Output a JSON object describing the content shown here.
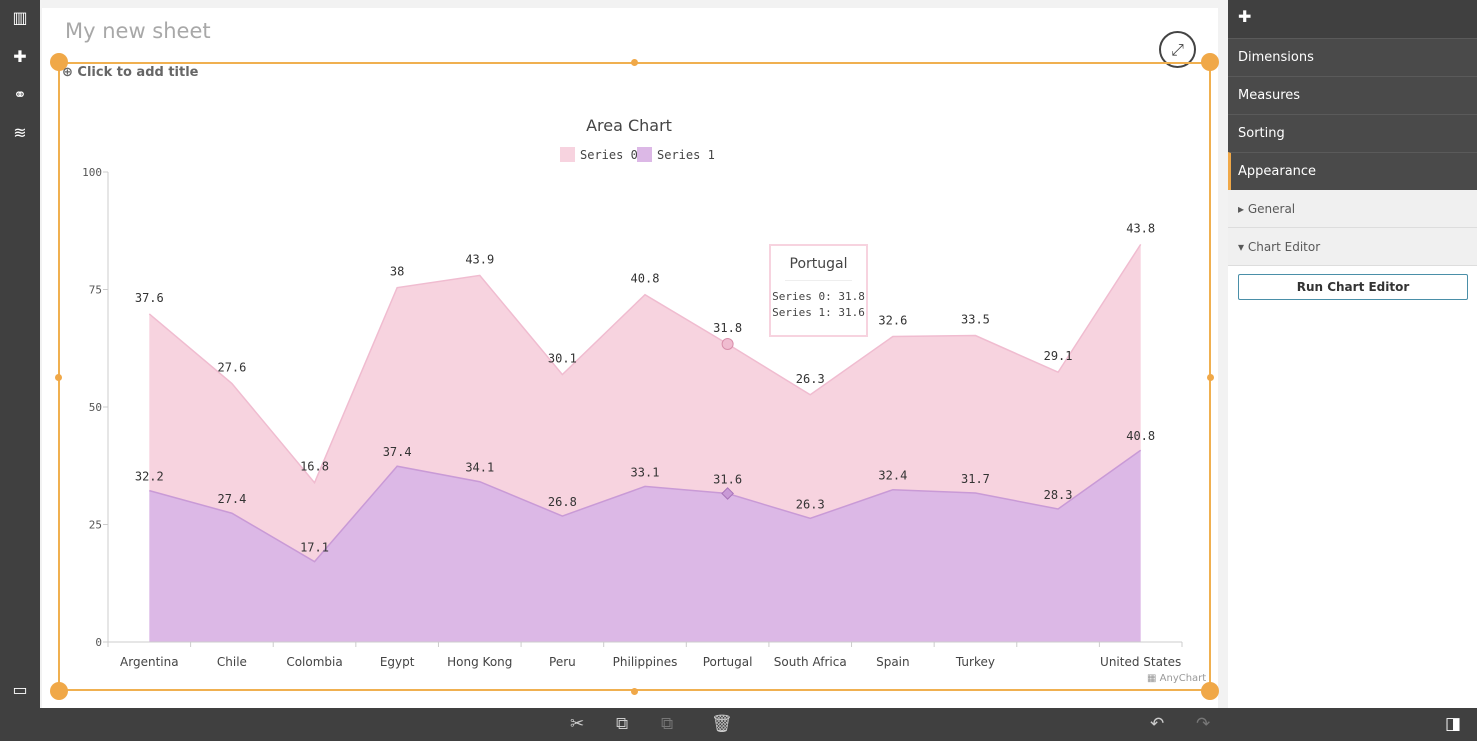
{
  "sheet": {
    "title": "My new sheet",
    "add_title": "Click to add title"
  },
  "leftbar": {
    "icons": [
      "chart-icon",
      "puzzle-icon",
      "link-icon",
      "database-icon"
    ]
  },
  "panel": {
    "items": [
      "Dimensions",
      "Measures",
      "Sorting",
      "Appearance"
    ],
    "active": "Appearance",
    "sections": [
      "General",
      "Chart Editor"
    ],
    "run_button": "Run Chart Editor"
  },
  "tooltip": {
    "title": "Portugal",
    "lines": [
      "Series 0: 31.8",
      "Series 1: 31.6"
    ]
  },
  "credit": "AnyChart",
  "colors": {
    "series0": "#f7d3df",
    "series1": "#dcb8e6",
    "accent": "#f0a848"
  },
  "chart_data": {
    "type": "area",
    "stacked": true,
    "title": "Area Chart",
    "legend_position": "top",
    "categories": [
      "Argentina",
      "Chile",
      "Colombia",
      "Egypt",
      "Hong Kong",
      "Peru",
      "Philippines",
      "Portugal",
      "South Africa",
      "Spain",
      "Turkey",
      "",
      "United States"
    ],
    "series": [
      {
        "name": "Series 0",
        "values": [
          37.6,
          27.6,
          16.8,
          38,
          43.9,
          30.1,
          40.8,
          31.8,
          26.3,
          32.6,
          33.5,
          29.1,
          43.8
        ]
      },
      {
        "name": "Series 1",
        "values": [
          32.2,
          27.4,
          17.1,
          37.4,
          34.1,
          26.8,
          33.1,
          31.6,
          26.3,
          32.4,
          31.7,
          28.3,
          40.8
        ]
      }
    ],
    "ylim": [
      0,
      100
    ],
    "yticks": [
      "0",
      "25",
      "50",
      "75",
      "100"
    ],
    "grid": false
  }
}
